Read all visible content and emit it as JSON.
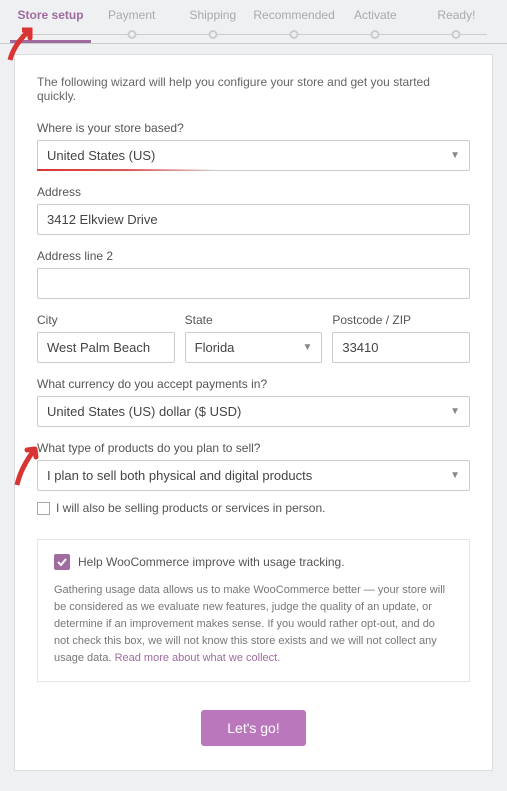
{
  "steps": {
    "s0": "Store setup",
    "s1": "Payment",
    "s2": "Shipping",
    "s3": "Recommended",
    "s4": "Activate",
    "s5": "Ready!"
  },
  "intro": "The following wizard will help you configure your store and get you started quickly.",
  "labels": {
    "where": "Where is your store based?",
    "address": "Address",
    "address2": "Address line 2",
    "city": "City",
    "state": "State",
    "postcode": "Postcode / ZIP",
    "currency": "What currency do you accept payments in?",
    "ptype": "What type of products do you plan to sell?"
  },
  "values": {
    "country": "United States (US)",
    "address": "3412 Elkview Drive",
    "address2": "",
    "city": "West Palm Beach",
    "state": "Florida",
    "postcode": "33410",
    "currency": "United States (US) dollar ($ USD)",
    "ptype": "I plan to sell both physical and digital products"
  },
  "inperson_label": "I will also be selling products or services in person.",
  "tracking": {
    "head": "Help WooCommerce improve with usage tracking.",
    "body": "Gathering usage data allows us to make WooCommerce better — your store will be considered as we evaluate new features, judge the quality of an update, or determine if an improvement makes sense. If you would rather opt-out, and do not check this box, we will not know this store exists and we will not collect any usage data. ",
    "link": "Read more about what we collect."
  },
  "go": "Let's go!"
}
